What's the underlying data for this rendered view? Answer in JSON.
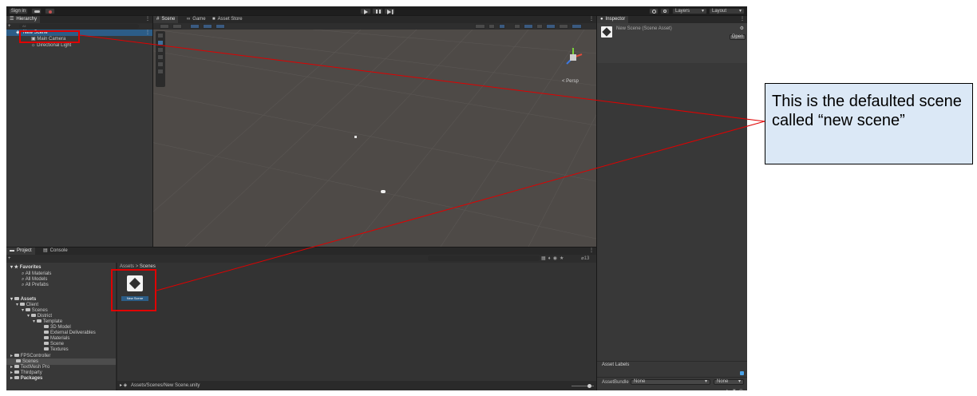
{
  "toolbar": {
    "sign_in": "Sign in",
    "cloud_icon": "cloud-icon",
    "collab_icon": "collab-icon",
    "play_icon": "play-icon",
    "pause_icon": "pause-icon",
    "step_icon": "step-icon",
    "history_icon": "history-icon",
    "search_icon": "search-icon",
    "layers": "Layers",
    "layout": "Layout"
  },
  "hierarchy": {
    "title": "Hierarchy",
    "add_label": "+",
    "search_placeholder": "All",
    "scene_name": "New Scene",
    "items": [
      "Main Camera",
      "Directional Light"
    ]
  },
  "scene_tabs": {
    "scene": "Scene",
    "game": "Game",
    "store": "Asset Store"
  },
  "scene_view": {
    "persp_label": "< Persp"
  },
  "inspector": {
    "title": "Inspector",
    "asset_name": "New Scene (Scene Asset)",
    "open": "Open",
    "asset_labels": "Asset Labels",
    "asset_bundle": "AssetBundle",
    "bundle_value": "None",
    "variant_value": "None"
  },
  "project": {
    "tab_project": "Project",
    "tab_console": "Console",
    "add_label": "+",
    "breadcrumb_root": "Assets",
    "breadcrumb_sep": ">",
    "breadcrumb_leaf": "Scenes",
    "count": "13",
    "footer_path": "Assets/Scenes/New Scene.unity",
    "asset_item": "New Scene",
    "favorites": {
      "label": "Favorites",
      "items": [
        "All Materials",
        "All Models",
        "All Prefabs"
      ]
    },
    "tree": {
      "assets": "Assets",
      "client": "Client",
      "scenes": "Scenes",
      "district": "District",
      "template": "Template",
      "template_children": [
        "3D Model",
        "External Deliverables",
        "Materials",
        "Scene",
        "Textures"
      ],
      "fps": "FPSController",
      "scenes2": "Scenes",
      "textmesh": "TextMesh Pro",
      "thirdparty": "Thirdparty",
      "packages": "Packages"
    }
  },
  "annotation": {
    "text": "This is the defaulted scene called “new scene”",
    "border_color": "#000000",
    "fill_color": "#dbe8f6",
    "highlight_color": "#e00000"
  }
}
